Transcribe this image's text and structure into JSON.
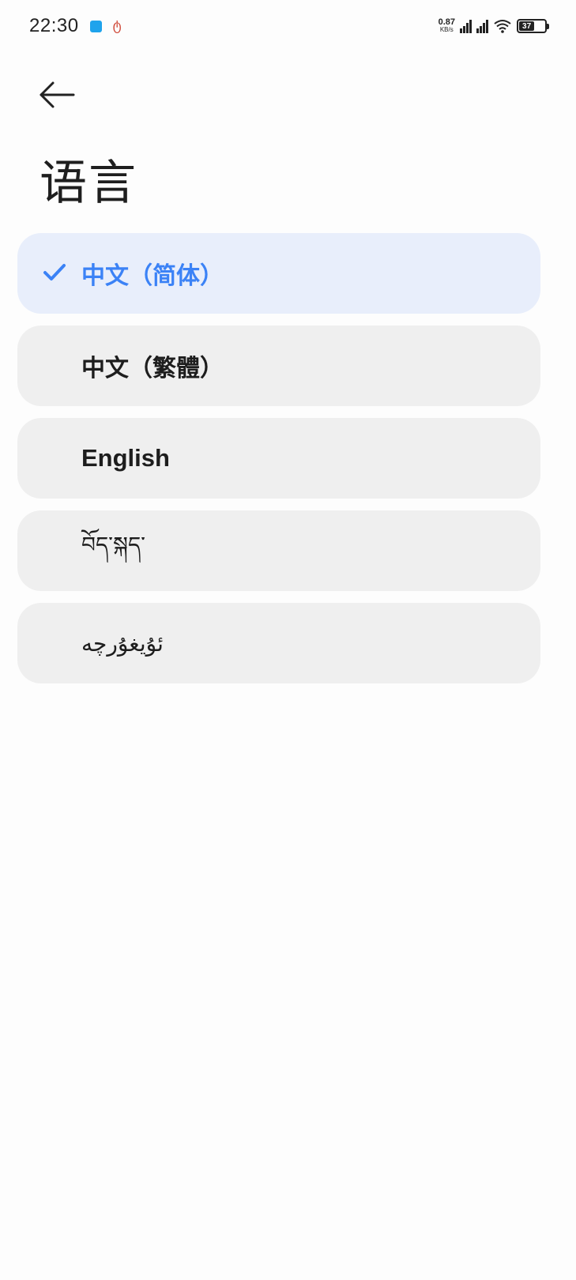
{
  "status_bar": {
    "time": "22:30",
    "net_speed_value": "0.87",
    "net_speed_unit": "KB/s",
    "battery_level": "37",
    "icons": [
      "notification-app-icon",
      "notification-app-2-icon",
      "signal-1-icon",
      "signal-2-icon",
      "wifi-icon",
      "battery-icon"
    ]
  },
  "header": {
    "back_icon": "arrow-left-icon",
    "title": "语言"
  },
  "languages": [
    {
      "label": "中文（简体）",
      "selected": true
    },
    {
      "label": "中文（繁體）",
      "selected": false
    },
    {
      "label": "English",
      "selected": false
    },
    {
      "label": "བོད་སྐད་",
      "selected": false
    },
    {
      "label": "ئۇيغۇرچە",
      "selected": false
    }
  ],
  "colors": {
    "accent": "#3b82f6",
    "selected_bg": "#e8eefb",
    "item_bg": "#efefef"
  }
}
